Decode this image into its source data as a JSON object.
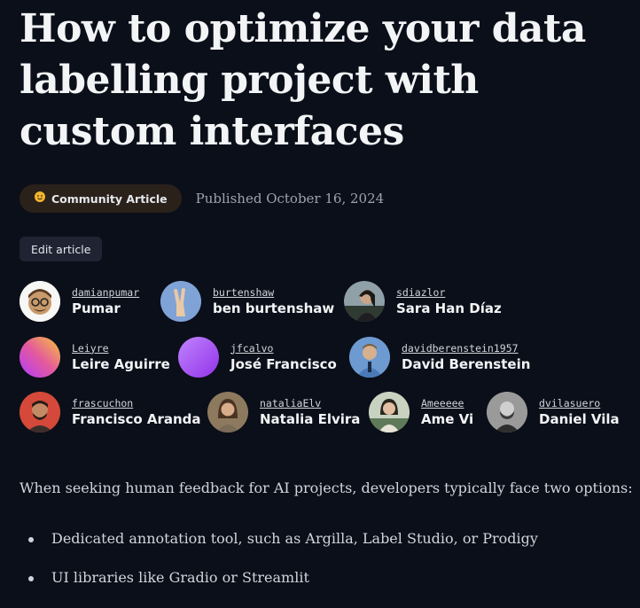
{
  "article": {
    "title": "How to optimize your data labelling project with custom interfaces",
    "badge": {
      "icon": "hugging-face-icon",
      "label": "Community Article"
    },
    "published": "Published October 16, 2024",
    "edit_label": "Edit article"
  },
  "authors": [
    {
      "handle": "damianpumar",
      "name": "Pumar",
      "avatar_color": "#f7f7f5"
    },
    {
      "handle": "burtenshaw",
      "name": "ben burtenshaw",
      "avatar_color": "#6c8fc7"
    },
    {
      "handle": "sdiazlor",
      "name": "Sara Han Díaz",
      "avatar_color": "#3a4452"
    },
    {
      "handle": "Leiyre",
      "name": "Leire Aguirre",
      "avatar_color": "#d6479c"
    },
    {
      "handle": "jfcalvo",
      "name": "José Francisco",
      "avatar_color": "#a855f7"
    },
    {
      "handle": "davidberenstein1957",
      "name": "David Berenstein",
      "avatar_color": "#5b8cc2"
    },
    {
      "handle": "frascuchon",
      "name": "Francisco Aranda",
      "avatar_color": "#d4493a"
    },
    {
      "handle": "nataliaElv",
      "name": "Natalia Elvira",
      "avatar_color": "#6b5a45"
    },
    {
      "handle": "Ameeeee",
      "name": "Ame Vi",
      "avatar_color": "#b8c4b0"
    },
    {
      "handle": "dvilasuero",
      "name": "Daniel Vila",
      "avatar_color": "#8a8a8a"
    }
  ],
  "content": {
    "intro": "When seeking human feedback for AI projects, developers typically face two options:",
    "bullets": [
      "Dedicated annotation tool, such as Argilla, Label Studio, or Prodigy",
      "UI libraries like Gradio or Streamlit"
    ]
  }
}
